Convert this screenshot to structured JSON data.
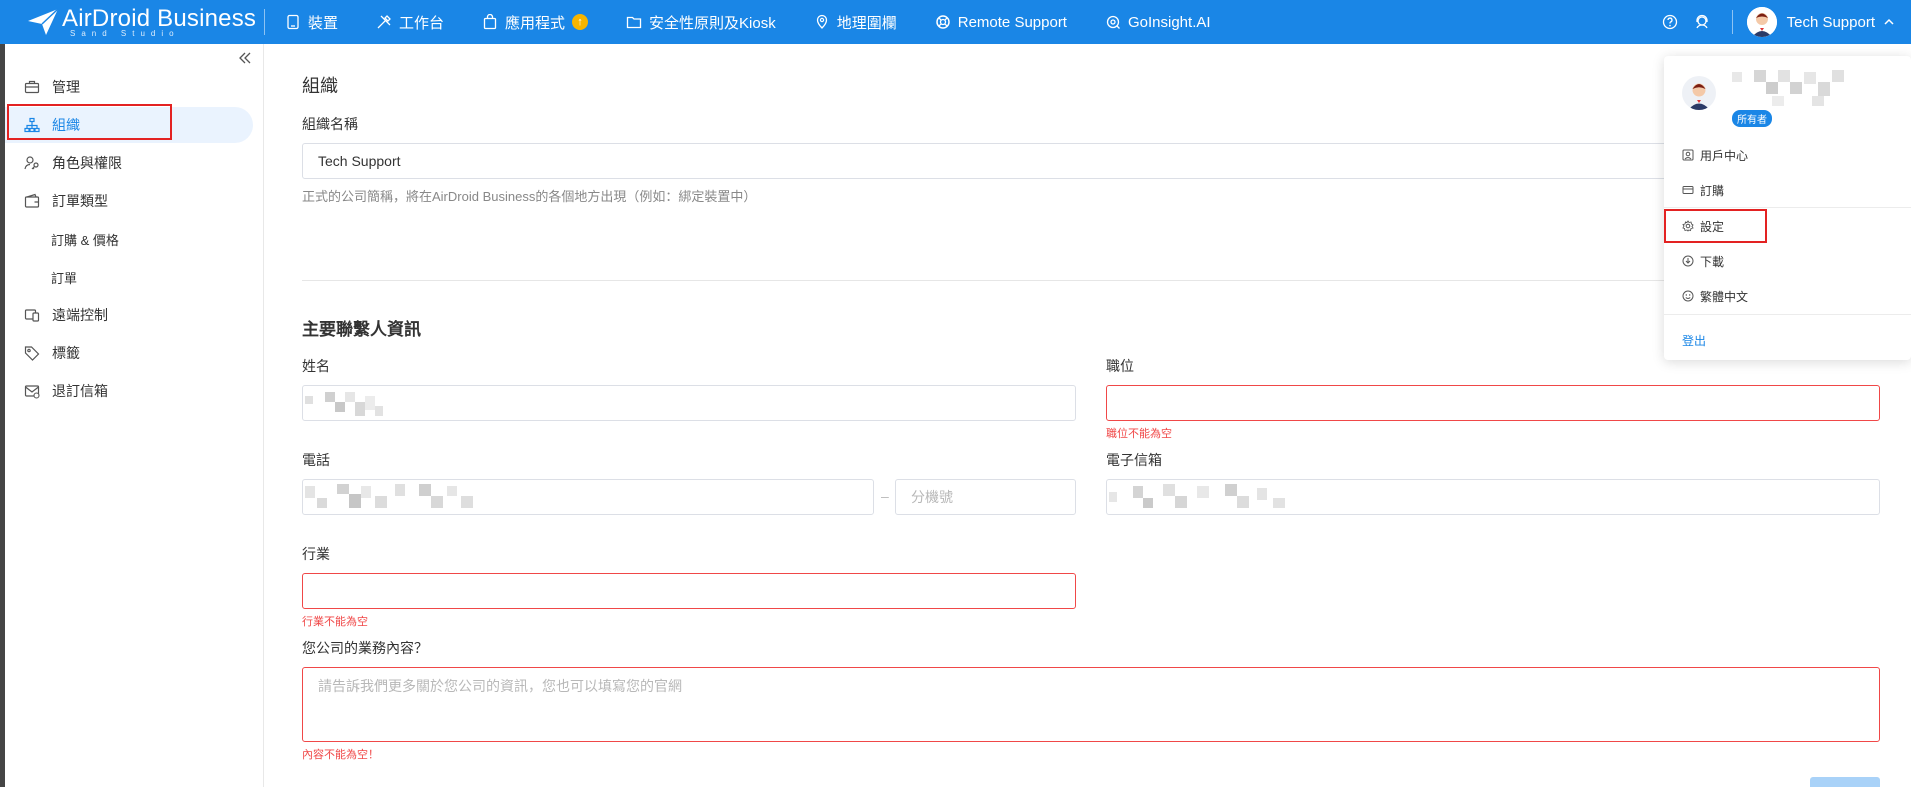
{
  "app": {
    "logo_text": "AirDroid Business",
    "logo_subtitle": "Sand Studio"
  },
  "nav": {
    "items": [
      {
        "label": "裝置",
        "icon": "tablet-icon"
      },
      {
        "label": "工作台",
        "icon": "tools-icon"
      },
      {
        "label": "應用程式",
        "icon": "bag-icon",
        "badge": "update-badge"
      },
      {
        "label": "安全性原則及Kiosk",
        "icon": "folder-icon"
      },
      {
        "label": "地理圍欄",
        "icon": "map-pin-icon"
      },
      {
        "label": "Remote Support",
        "icon": "lifebuoy-icon"
      },
      {
        "label": "GoInsight.AI",
        "icon": "insight-icon"
      }
    ],
    "user_name": "Tech Support"
  },
  "sidebar": {
    "items": [
      {
        "label": "管理",
        "icon": "briefcase-icon"
      },
      {
        "label": "組織",
        "icon": "org-chart-icon"
      },
      {
        "label": "角色與權限",
        "icon": "user-key-icon"
      },
      {
        "label": "訂單類型",
        "icon": "wallet-icon"
      },
      {
        "label": "訂購 & 價格"
      },
      {
        "label": "訂單"
      },
      {
        "label": "遠端控制",
        "icon": "remote-icon"
      },
      {
        "label": "標籤",
        "icon": "tag-icon"
      },
      {
        "label": "退訂信箱",
        "icon": "mail-icon"
      }
    ],
    "active": "組織"
  },
  "org": {
    "title": "組織",
    "name_label": "組織名稱",
    "name_value": "Tech Support",
    "name_hint": "正式的公司簡稱，將在AirDroid Business的各個地方出現（例如：綁定裝置中）"
  },
  "contact": {
    "title": "主要聯繫人資訊",
    "name_label": "姓名",
    "position_label": "職位",
    "position_error": "職位不能為空",
    "phone_label": "電話",
    "ext_placeholder": "分機號",
    "email_label": "電子信箱",
    "industry_label": "行業",
    "industry_error": "行業不能為空",
    "business_label": "您公司的業務內容？",
    "business_placeholder": "請告訴我們更多關於您公司的資訊，您也可以填寫您的官網",
    "business_error": "內容不能為空！"
  },
  "dropdown": {
    "owner_badge": "所有者",
    "items": [
      {
        "label": "用戶中心",
        "icon": "user-center-icon"
      },
      {
        "label": "訂購",
        "icon": "card-icon"
      },
      {
        "label": "設定",
        "icon": "gear-icon"
      },
      {
        "label": "下載",
        "icon": "download-icon"
      },
      {
        "label": "繁體中文",
        "icon": "globe-icon"
      }
    ],
    "logout": "登出"
  },
  "colors": {
    "brand": "#1a86e6",
    "error": "#f04848",
    "highlight": "#e32222"
  }
}
